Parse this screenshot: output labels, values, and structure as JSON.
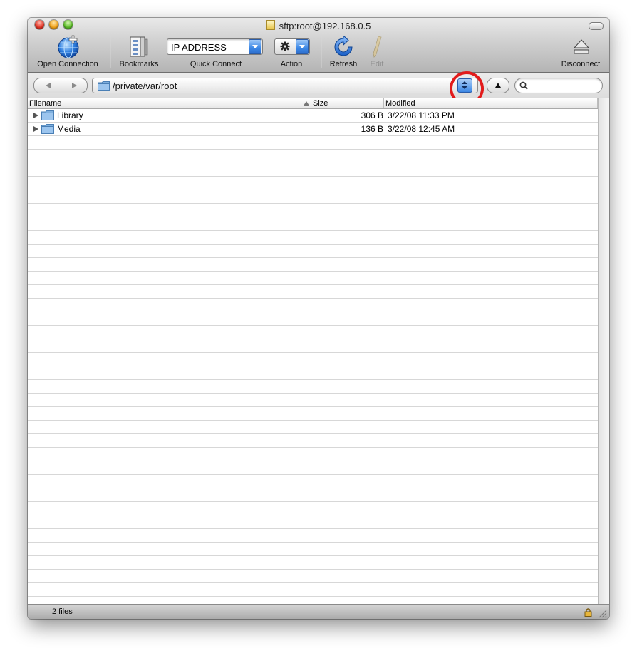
{
  "window": {
    "title": "sftp:root@192.168.0.5"
  },
  "toolbar": {
    "open_connection": "Open Connection",
    "bookmarks": "Bookmarks",
    "quick_connect_label": "Quick Connect",
    "quick_connect_value": "IP ADDRESS",
    "action": "Action",
    "refresh": "Refresh",
    "edit": "Edit",
    "disconnect": "Disconnect"
  },
  "pathbar": {
    "path": "/private/var/root",
    "search_placeholder": ""
  },
  "table": {
    "columns": [
      "Filename",
      "Size",
      "Modified"
    ],
    "rows": [
      {
        "name": "Library",
        "size": "306 B",
        "modified": "3/22/08 11:33 PM"
      },
      {
        "name": "Media",
        "size": "136 B",
        "modified": "3/22/08 12:45 AM"
      }
    ]
  },
  "status": {
    "count": "2 files"
  },
  "colors": {
    "annotation_circle": "#e21b1b",
    "accent_blue": "#3c88e6",
    "folder_blue": "#7fb0df"
  },
  "icons": [
    "close-icon",
    "minimize-icon",
    "zoom-icon",
    "globe-plus-icon",
    "bookmarks-icon",
    "gear-icon",
    "refresh-icon",
    "pencil-icon",
    "eject-icon",
    "back-arrow-icon",
    "forward-arrow-icon",
    "folder-icon",
    "up-arrow-icon",
    "search-icon",
    "disclosure-triangle-icon",
    "lock-icon",
    "resize-grip-icon"
  ]
}
